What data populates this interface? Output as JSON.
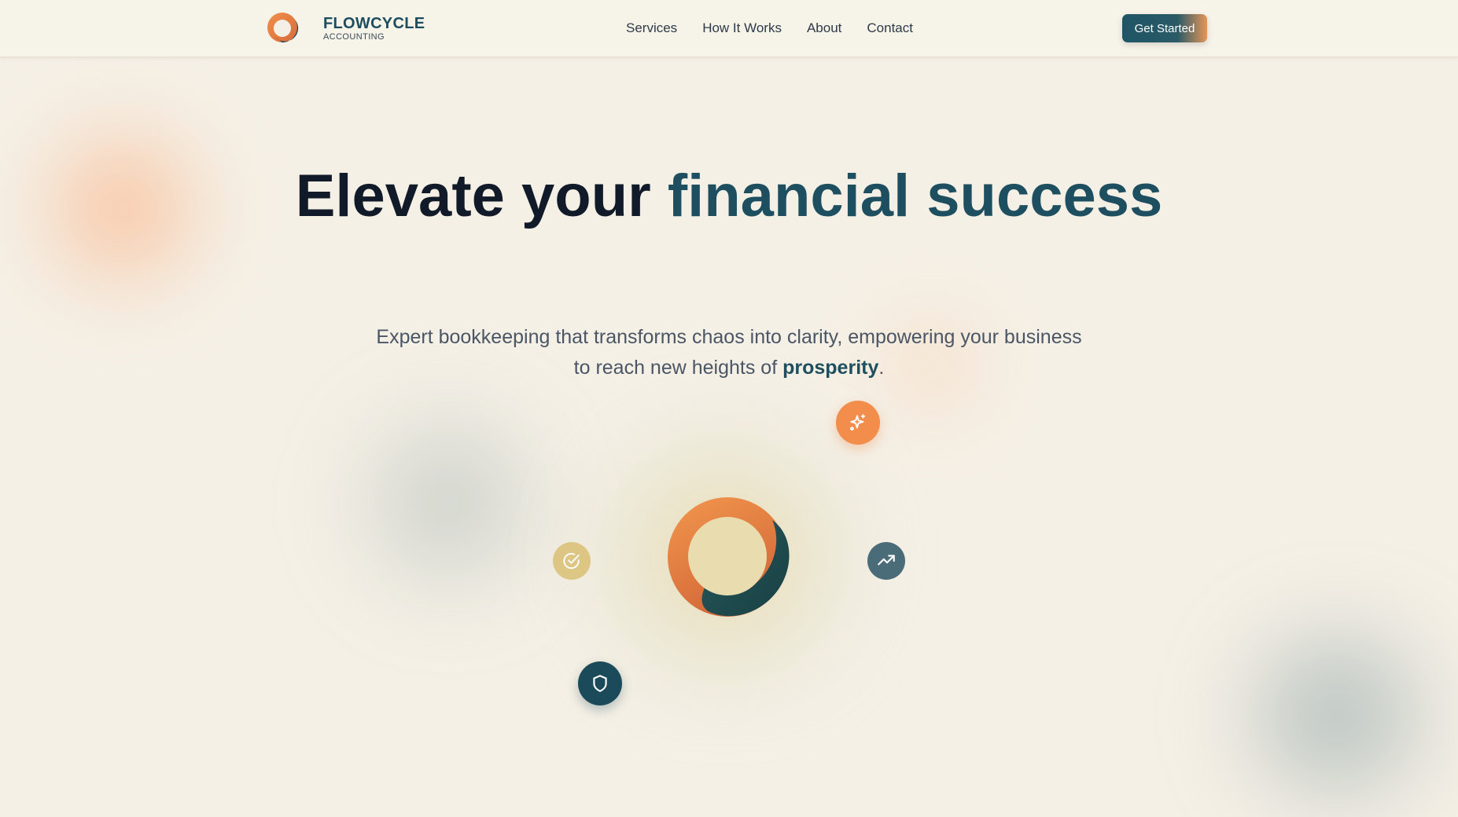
{
  "header": {
    "brand_name": "FLOWCYCLE",
    "brand_subtitle": "ACCOUNTING",
    "logo_icon": "flowcycle-ring-logo-icon",
    "nav": [
      {
        "label": "Services"
      },
      {
        "label": "How It Works"
      },
      {
        "label": "About"
      },
      {
        "label": "Contact"
      }
    ],
    "cta_label": "Get Started"
  },
  "hero": {
    "title_part1": "Elevate your ",
    "title_part2": "financial success",
    "subtitle_part1": "Expert bookkeeping that transforms chaos into clarity, empowering your business to reach new heights of ",
    "subtitle_emphasis": "prosperity",
    "subtitle_end": ".",
    "center_icon": "flowcycle-ring-logo-icon",
    "floating_icons": [
      "sparkle-icon",
      "check-circle-icon",
      "trending-up-icon",
      "shield-icon"
    ]
  },
  "colors": {
    "background": "#f5f0e6",
    "brand_teal": "#1e4f60",
    "brand_orange": "#f28d4b",
    "heading_dark": "#111a28",
    "gold": "#dcc37b"
  }
}
